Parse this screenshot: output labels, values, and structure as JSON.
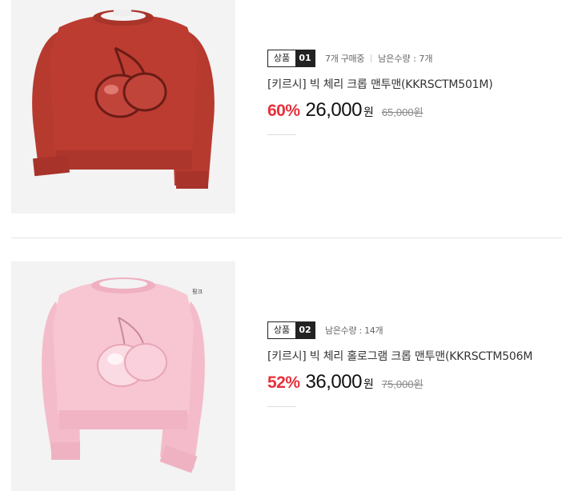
{
  "products": [
    {
      "badge_label": "상품",
      "badge_num": "01",
      "purchase_count": "7개 구매중",
      "stock": "남은수량 : 7개",
      "title": "[키르시] 빅 체리 크롭 맨투맨(KKRSCTM501M)",
      "discount": "60%",
      "price": "26,000",
      "currency": "원",
      "original_price": "65,000",
      "image_color": "#b93a2e"
    },
    {
      "badge_label": "상품",
      "badge_num": "02",
      "stock": "남은수량 : 14개",
      "title": "[키르시] 빅 체리 홀로그램 크롭 맨투맨(KKRSCTM506M",
      "discount": "52%",
      "price": "36,000",
      "currency": "원",
      "original_price": "75,000",
      "image_color": "#f6c3d0",
      "image_caption": "핑크"
    }
  ]
}
